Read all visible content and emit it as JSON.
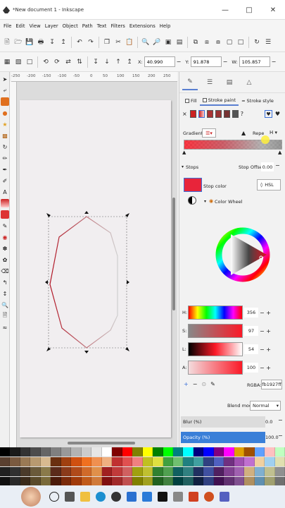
{
  "window": {
    "title": "*New document 1 - Inkscape"
  },
  "menu": [
    "File",
    "Edit",
    "View",
    "Layer",
    "Object",
    "Path",
    "Text",
    "Filters",
    "Extensions",
    "Help"
  ],
  "coords": {
    "x_label": "X:",
    "x_value": "40.990",
    "y_label": "Y:",
    "y_value": "91.878",
    "w_label": "W:",
    "w_value": "105.857"
  },
  "ruler": [
    "-250",
    "-200",
    "-150",
    "-100",
    "-50",
    "0",
    "50",
    "100",
    "150",
    "200",
    "250"
  ],
  "panel": {
    "fill_tab": "Fill",
    "stroke_paint_tab": "Stroke paint",
    "stroke_style_tab": "Stroke style",
    "x_label": "×",
    "question": "?",
    "gradient_label": "Gradient:",
    "repeat_label": "Repe",
    "stops_label": "Stops",
    "stop_offset_label": "Stop Offset:",
    "stop_offset_value": "0.00",
    "stop_color_label": "Stop color",
    "mode_select": "HSL",
    "color_wheel_label": "Color Wheel",
    "sliders": [
      {
        "label": "H:",
        "value": "356"
      },
      {
        "label": "S:",
        "value": "97"
      },
      {
        "label": "L:",
        "value": "54"
      },
      {
        "label": "A:",
        "value": "100"
      }
    ],
    "rgba_label": "RGBA:",
    "rgba_value": "fb1927ff",
    "blend_label": "Blend mode:",
    "blend_value": "Normal",
    "blur_label": "Blur (%)",
    "blur_value": "0.0",
    "opacity_label": "Opacity (%)",
    "opacity_value": "100.0"
  },
  "colors": {
    "accent": "#3a7fd8",
    "stop": "#fb1927",
    "stroke_start": "#b01020",
    "stroke_end": "#cfcfcf"
  }
}
